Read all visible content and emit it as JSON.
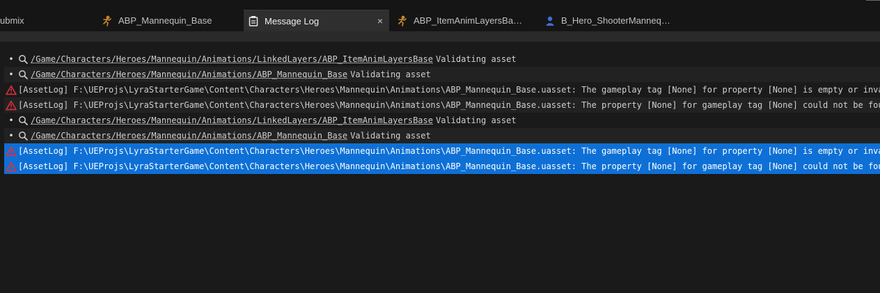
{
  "tabs": [
    {
      "label": "ubmix",
      "icon": "",
      "active": false
    },
    {
      "label": "ABP_Mannequin_Base",
      "icon": "anim-blueprint-icon",
      "active": false
    },
    {
      "label": "Message Log",
      "icon": "message-log-icon",
      "active": true,
      "close": "×"
    },
    {
      "label": "ABP_ItemAnimLayersBa…",
      "icon": "anim-blueprint-icon",
      "active": false
    },
    {
      "label": "B_Hero_ShooterManneq…",
      "icon": "character-blueprint-icon",
      "active": false
    }
  ],
  "log": {
    "rows": [
      {
        "type": "info",
        "link": "/Game/Characters/Heroes/Mannequin/Animations/LinkedLayers/ABP_ItemAnimLayersBase",
        "message": "Validating asset",
        "selected": false
      },
      {
        "type": "info",
        "link": "/Game/Characters/Heroes/Mannequin/Animations/ABP_Mannequin_Base",
        "message": "Validating asset",
        "selected": false
      },
      {
        "type": "error",
        "message": "[AssetLog] F:\\UEProjs\\LyraStarterGame\\Content\\Characters\\Heroes\\Mannequin\\Animations\\ABP_Mannequin_Base.uasset: The gameplay tag [None] for property [None] is empty or invalid.",
        "selected": false
      },
      {
        "type": "error",
        "message": "[AssetLog] F:\\UEProjs\\LyraStarterGame\\Content\\Characters\\Heroes\\Mannequin\\Animations\\ABP_Mannequin_Base.uasset: The property [None] for gameplay tag [None] could not be found.",
        "selected": false
      },
      {
        "type": "info",
        "link": "/Game/Characters/Heroes/Mannequin/Animations/LinkedLayers/ABP_ItemAnimLayersBase",
        "message": "Validating asset",
        "selected": false
      },
      {
        "type": "info",
        "link": "/Game/Characters/Heroes/Mannequin/Animations/ABP_Mannequin_Base",
        "message": "Validating asset",
        "selected": false
      },
      {
        "type": "error",
        "message": "[AssetLog] F:\\UEProjs\\LyraStarterGame\\Content\\Characters\\Heroes\\Mannequin\\Animations\\ABP_Mannequin_Base.uasset: The gameplay tag [None] for property [None] is empty or invalid.",
        "selected": true
      },
      {
        "type": "error",
        "message": "[AssetLog] F:\\UEProjs\\LyraStarterGame\\Content\\Characters\\Heroes\\Mannequin\\Animations\\ABP_Mannequin_Base.uasset: The property [None] for gameplay tag [None] could not be found.",
        "selected": true
      }
    ]
  },
  "colors": {
    "selection": "#0e70d6",
    "error_icon": "#e0303a",
    "anim_icon": "#c8882a",
    "character_icon": "#3f6fd8"
  }
}
